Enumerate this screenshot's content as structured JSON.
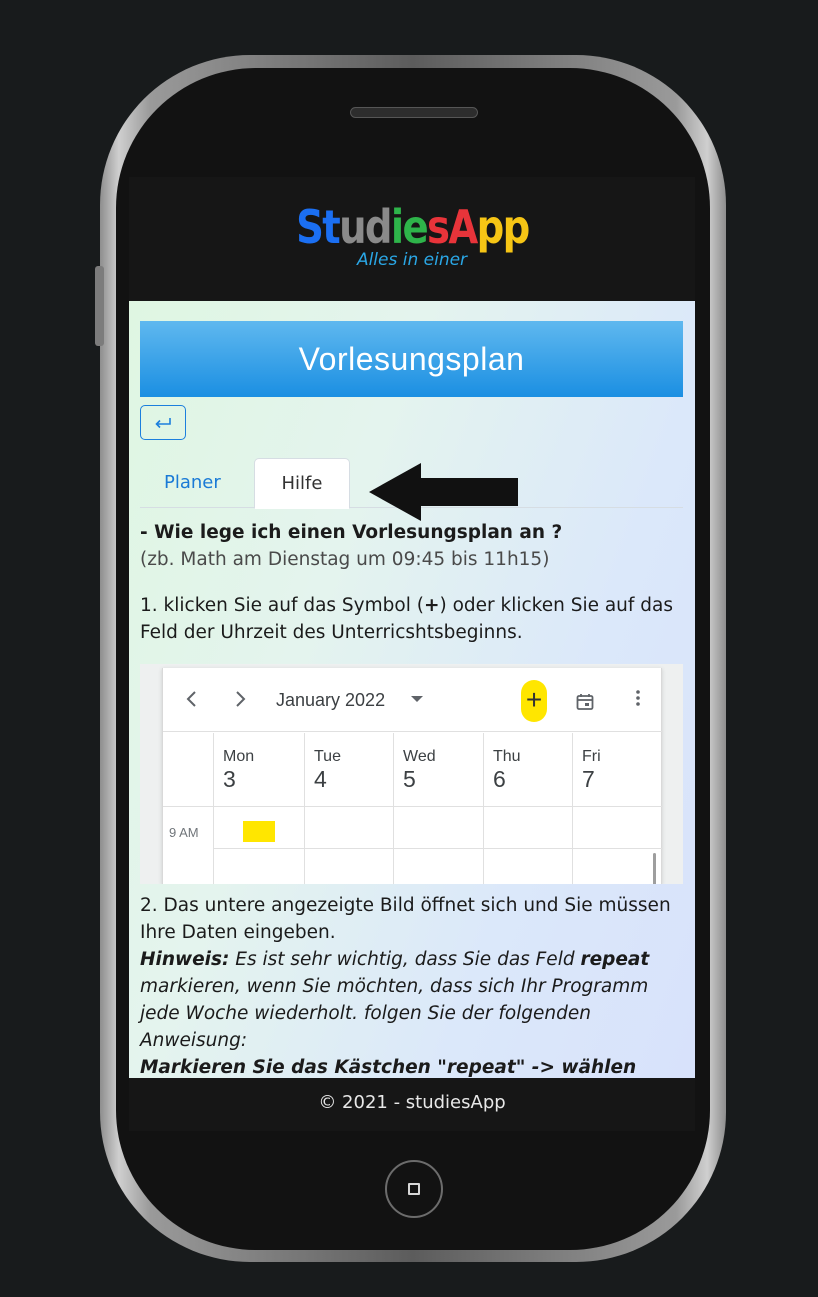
{
  "app": {
    "logo_letters": [
      {
        "char": "S",
        "color": "#1b6ff2"
      },
      {
        "char": "t",
        "color": "#1b6ff2"
      },
      {
        "char": "u",
        "color": "#8a8a8a"
      },
      {
        "char": "d",
        "color": "#8a8a8a"
      },
      {
        "char": "i",
        "color": "#2eb44a"
      },
      {
        "char": "e",
        "color": "#2eb44a"
      },
      {
        "char": "s",
        "color": "#e8343a"
      },
      {
        "char": "A",
        "color": "#e8343a"
      },
      {
        "char": "p",
        "color": "#f6c515"
      },
      {
        "char": "p",
        "color": "#f6c515"
      }
    ],
    "tagline": "Alles in einer",
    "tagline_color": "#2aa7e6",
    "accent_color": "#1a7ad6"
  },
  "page": {
    "title": "Vorlesungsplan",
    "back_icon": "return-arrow-icon"
  },
  "tabs": [
    {
      "label": "Planer",
      "active": false
    },
    {
      "label": "Hilfe",
      "active": true
    }
  ],
  "help": {
    "question": "- Wie lege ich einen Vorlesungsplan an ?",
    "example": "(zb. Math am Dienstag um 09:45 bis 11h15)",
    "step1_a": "1. klicken Sie auf das Symbol (",
    "step1_plus": "+",
    "step1_b": ") oder klicken Sie auf das Feld der Uhrzeit des Unterricshtsbeginns.",
    "step2": "2. Das untere angezeigte Bild öffnet sich und Sie müssen Ihre Daten eingeben.",
    "hint_label": "Hinweis:",
    "hint_a": " Es ist sehr wichtig, dass Sie das Feld ",
    "hint_repeat": "repeat",
    "hint_b": " markieren, wenn Sie möchten, dass sich Ihr Programm jede Woche wiederholt. folgen Sie der folgenden Anweisung:",
    "instruction": "Markieren Sie das Kästchen \"repeat\" -> wählen"
  },
  "calendar": {
    "prev_icon": "chevron-left-icon",
    "next_icon": "chevron-right-icon",
    "month": "January 2022",
    "add_icon": "plus-icon",
    "today_icon": "calendar-today-icon",
    "more_icon": "more-vert-icon",
    "days": [
      {
        "name": "Mon",
        "num": "3"
      },
      {
        "name": "Tue",
        "num": "4"
      },
      {
        "name": "Wed",
        "num": "5"
      },
      {
        "name": "Thu",
        "num": "6"
      },
      {
        "name": "Fri",
        "num": "7"
      }
    ],
    "time_label": "9 AM",
    "highlight_color": "#ffe600"
  },
  "footer": {
    "text": "© 2021 - studiesApp"
  }
}
